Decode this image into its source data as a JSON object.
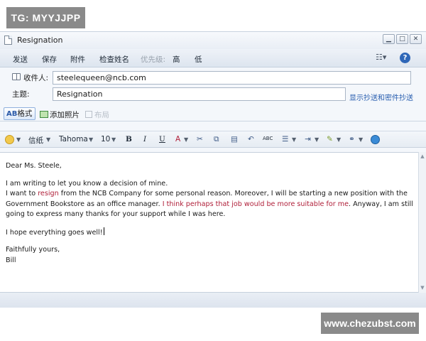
{
  "watermarks": {
    "top_left": "TG: MYYJJPP",
    "bottom_right": "www.chezubst.com"
  },
  "window": {
    "title": "Resignation"
  },
  "toolbar1": {
    "send": "发送",
    "save": "保存",
    "attach": "附件",
    "check_names": "检查姓名",
    "priority_label": "优先级:",
    "high": "高",
    "low": "低"
  },
  "header": {
    "to_label": "收件人:",
    "to_value": "steelequeen@ncb.com",
    "subject_label": "主题:",
    "subject_value": "Resignation",
    "cc_bcc_link": "显示抄送和密件抄送"
  },
  "toolbar2": {
    "format": "格式",
    "add_photo": "添加照片",
    "layout": "布局"
  },
  "toolbar3": {
    "stationery": "信纸",
    "font": "Tahoma",
    "size": "10",
    "bold": "B",
    "italic": "I",
    "underline": "U",
    "font_color": "A",
    "spell": "ABC"
  },
  "email": {
    "greeting": "Dear Ms. Steele,",
    "l1": "I am writing to let you know a decision of mine.",
    "l2a": "I want to ",
    "l2b": "resign",
    "l2c": " from the NCB Company for some personal reason. Moreover, I will be starting a new position with the",
    "l3a": "Government Bookstore as an office manager. ",
    "l3b": "I think perhaps that job would be more suitable for me",
    "l3c": ". Anyway, I am still",
    "l4": "going to express many thanks for your support while I was here.",
    "l5": "I hope everything goes well!",
    "closing": "Faithfully yours,",
    "signature": "Bill"
  },
  "colors": {
    "accent_red": "#b0203a",
    "link_blue": "#2a5fb0",
    "chrome_bg": "#f4f7fb"
  }
}
